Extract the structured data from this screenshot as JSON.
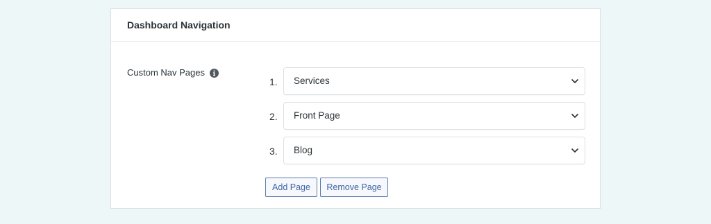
{
  "panel": {
    "title": "Dashboard Navigation"
  },
  "field": {
    "label": "Custom Nav Pages",
    "info_icon": "info-circle-icon"
  },
  "nav_pages": [
    {
      "index": "1.",
      "value": "Services"
    },
    {
      "index": "2.",
      "value": "Front Page"
    },
    {
      "index": "3.",
      "value": "Blog"
    }
  ],
  "buttons": {
    "add_label": "Add Page",
    "remove_label": "Remove Page"
  },
  "colors": {
    "background": "#eef7f7",
    "panel": "#ffffff",
    "accent": "#3e67a8",
    "text": "#2c3338"
  }
}
